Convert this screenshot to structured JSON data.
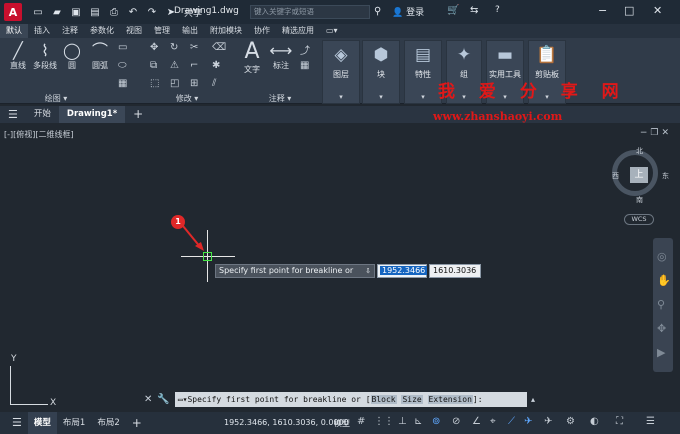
{
  "app": {
    "logo": "A",
    "share_label": "共享",
    "doc_title": "Drawing1.dwg",
    "search_placeholder": "键入关键字或短语",
    "login_label": "登录",
    "help_icon": "?"
  },
  "menu_tabs": [
    "默认",
    "插入",
    "注释",
    "参数化",
    "视图",
    "管理",
    "输出",
    "附加模块",
    "协作",
    "精选应用"
  ],
  "ribbon": {
    "draw_tools": [
      "直线",
      "多段线",
      "圆",
      "圆弧"
    ],
    "text_tools": [
      "文字",
      "标注"
    ],
    "panels": [
      "图层",
      "块",
      "特性",
      "组",
      "实用工具",
      "剪贴板"
    ],
    "panel_footers": [
      "绘图",
      "修改",
      "注释"
    ]
  },
  "watermark": {
    "title": "我 爱 分 享 网",
    "url": "www.zhanshaoyi.com"
  },
  "file_tabs": {
    "start": "开始",
    "active": "Drawing1*",
    "add": "+"
  },
  "viewport": {
    "label": "[-][俯视][二维线框]",
    "compass": {
      "north": "北",
      "south": "南",
      "east": "东",
      "west": "西",
      "face": "上"
    },
    "wcs": "WCS"
  },
  "dynamic_input": {
    "prompt": "Specify first point for breakline or",
    "x_value": "1952.3466",
    "y_value": "1610.3036",
    "badge": "1"
  },
  "ucs": {
    "x": "X",
    "y": "Y"
  },
  "command_line": {
    "prefix": "Specify first point for breakline or [",
    "opt1": "Block",
    "opt2": "Size",
    "opt3": "Extension",
    "suffix": "]:"
  },
  "status": {
    "tabs": [
      "模型",
      "布局1",
      "布局2"
    ],
    "coords": "1952.3466, 1610.3036, 0.0000",
    "model_button": "模型"
  },
  "colors": {
    "accent": "#1565c0",
    "logo_red": "#c8102e",
    "watermark_red": "#e01818",
    "pick_green": "#47e747"
  }
}
